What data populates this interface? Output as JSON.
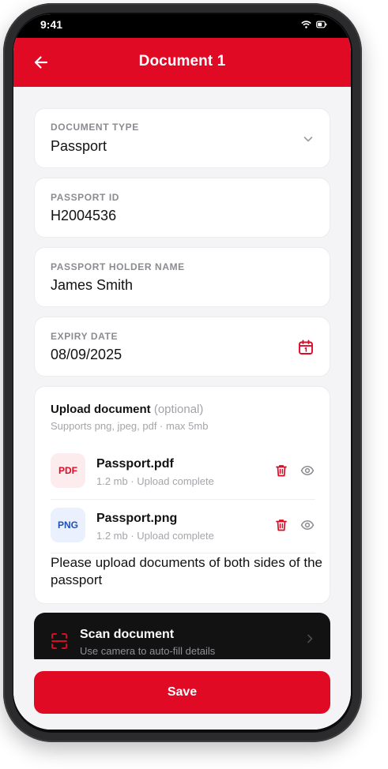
{
  "status_bar": {
    "time": "9:41"
  },
  "header": {
    "title": "Document 1",
    "back_icon": "arrow-left-icon"
  },
  "fields": {
    "document_type": {
      "label": "DOCUMENT TYPE",
      "value": "Passport"
    },
    "passport_id": {
      "label": "PASSPORT ID",
      "value": "H2004536"
    },
    "holder_name": {
      "label": "PASSPORT HOLDER NAME",
      "value": "James Smith"
    },
    "expiry_date": {
      "label": "EXPIRY DATE",
      "value": "08/09/2025"
    }
  },
  "upload": {
    "title": "Upload document",
    "optional": "(optional)",
    "hint": "Supports png, jpeg, pdf · max 5mb",
    "files": [
      {
        "badge": "PDF",
        "name": "Passport.pdf",
        "meta": "1.2 mb · Upload complete"
      },
      {
        "badge": "PNG",
        "name": "Passport.png",
        "meta": "1.2 mb · Upload complete"
      }
    ],
    "note": "Please upload documents of both sides of the passport"
  },
  "scan": {
    "title": "Scan document",
    "subtitle": "Use camera to auto-fill details"
  },
  "actions": {
    "save_label": "Save"
  },
  "colors": {
    "brand_red": "#e00a25",
    "pdf_badge_bg": "#fdecee",
    "png_badge_bg": "#eaf0fd",
    "png_badge_text": "#1f4fb8",
    "dark_card": "#121212"
  }
}
